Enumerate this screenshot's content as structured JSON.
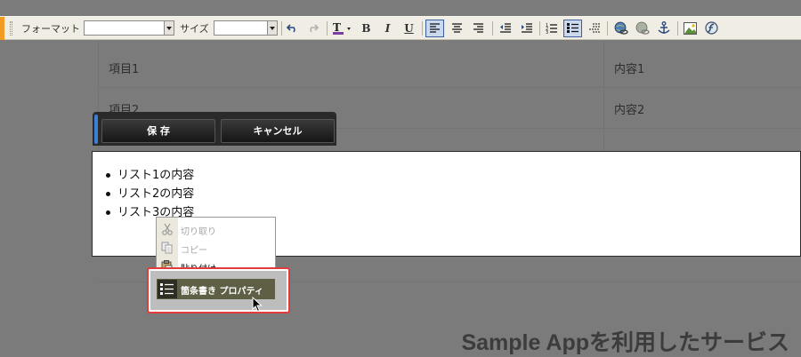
{
  "toolbar": {
    "format_label": "フォーマット",
    "format_value": "",
    "size_label": "サイズ",
    "size_value": "",
    "buttons": [
      {
        "name": "undo-icon"
      },
      {
        "name": "redo-icon"
      },
      {
        "name": "text-color-icon"
      },
      {
        "name": "bold-icon",
        "glyph": "B"
      },
      {
        "name": "italic-icon",
        "glyph": "I"
      },
      {
        "name": "underline-icon",
        "glyph": "U"
      },
      {
        "name": "align-left-icon"
      },
      {
        "name": "align-center-icon"
      },
      {
        "name": "align-right-icon"
      },
      {
        "name": "outdent-icon"
      },
      {
        "name": "indent-icon"
      },
      {
        "name": "numbered-list-icon"
      },
      {
        "name": "bulleted-list-icon"
      },
      {
        "name": "horizontal-rule-icon"
      },
      {
        "name": "link-icon"
      },
      {
        "name": "unlink-icon"
      },
      {
        "name": "anchor-icon"
      },
      {
        "name": "image-icon"
      },
      {
        "name": "flash-icon"
      }
    ],
    "accent_color": "#f29a21",
    "active_color": "#cbd9ee"
  },
  "table": {
    "rows": [
      {
        "item": "項目1",
        "content": "内容1"
      },
      {
        "item": "項目2",
        "content": "内容2"
      }
    ]
  },
  "actions": {
    "save_label": "保 存",
    "cancel_label": "キャンセル"
  },
  "editor": {
    "list_items": [
      "リスト1の内容",
      "リスト2の内容",
      "リスト3の内容"
    ]
  },
  "context_menu": {
    "items": [
      {
        "label": "切り取り",
        "icon": "scissors-icon",
        "enabled": false
      },
      {
        "label": "コピー",
        "icon": "copy-icon",
        "enabled": false
      },
      {
        "label": "貼り付け",
        "icon": "paste-icon",
        "enabled": true
      }
    ],
    "highlighted": {
      "label": "箇条書き プロパティ",
      "icon": "bulleted-list-icon"
    }
  },
  "footer": {
    "title": "Sample Appを利用したサービス"
  }
}
